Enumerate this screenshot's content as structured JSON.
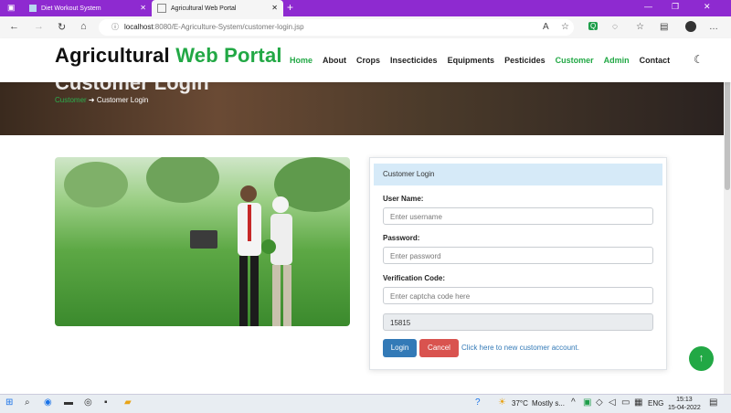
{
  "browser": {
    "tabs": [
      {
        "title": "Diet Workout System",
        "active": false
      },
      {
        "title": "Agricultural Web Portal",
        "active": true
      }
    ],
    "url_host": "localhost",
    "url_rest": ":8080/E-Agriculture-System/customer-login.jsp"
  },
  "site": {
    "brand_black": "Agricultural ",
    "brand_green": "Web Portal",
    "nav": [
      "Home",
      "About",
      "Crops",
      "Insecticides",
      "Equipments",
      "Pesticides",
      "Customer",
      "Admin",
      "Contact"
    ],
    "accent_color": "#22a845"
  },
  "hero": {
    "title": "Customer Login",
    "breadcrumb_parent": "Customer",
    "breadcrumb_current": "Customer Login"
  },
  "login_card": {
    "header": "Customer Login",
    "username_label": "User Name:",
    "username_placeholder": "Enter username",
    "password_label": "Password:",
    "password_placeholder": "Enter password",
    "captcha_label": "Verification Code:",
    "captcha_placeholder": "Enter captcha code here",
    "captcha_value": "15815",
    "login_button": "Login",
    "cancel_button": "Cancel",
    "register_link": "Click here to new customer account."
  },
  "taskbar": {
    "weather": "37°C",
    "weather_desc": "Mostly s...",
    "lang": "ENG",
    "time": "15:13",
    "date": "15-04-2022"
  }
}
